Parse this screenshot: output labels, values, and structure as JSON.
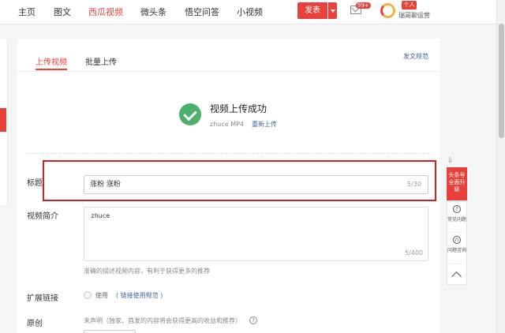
{
  "nav": {
    "items": [
      "主页",
      "图文",
      "西瓜视频",
      "微头条",
      "悟空问答",
      "小视频"
    ],
    "publish": "发表",
    "badge": "99+",
    "tag": "个人",
    "username": "瑞哥聊运营"
  },
  "tabs": [
    "上传视频",
    "批量上传"
  ],
  "spec_link": "发文规范",
  "upload": {
    "title": "视频上传成功",
    "file": "zhuce MP4",
    "reupload": "重新上传"
  },
  "form": {
    "title_label": "标题",
    "title_value": "涨粉 涨粉",
    "title_count": "5/30",
    "desc_label": "视频简介",
    "desc_value": "zhuce",
    "desc_count": "5/400",
    "desc_hint": "准确的描述视频内容，有利于获得更多的推荐",
    "ext_label": "扩展链接",
    "ext_use": "使用",
    "ext_link": "( 链接使用规范 )",
    "orig_label": "原创",
    "orig_hint": "未声明（独家、首发的内容将会获得更高的收益和推荐）"
  },
  "sidebar": {
    "upgrade": "头条号全面升级",
    "faq": "常见问题",
    "feedback": "问题咨询"
  },
  "colors": {
    "accent": "#e8413c",
    "link": "#406599",
    "success": "#4caf6a"
  }
}
